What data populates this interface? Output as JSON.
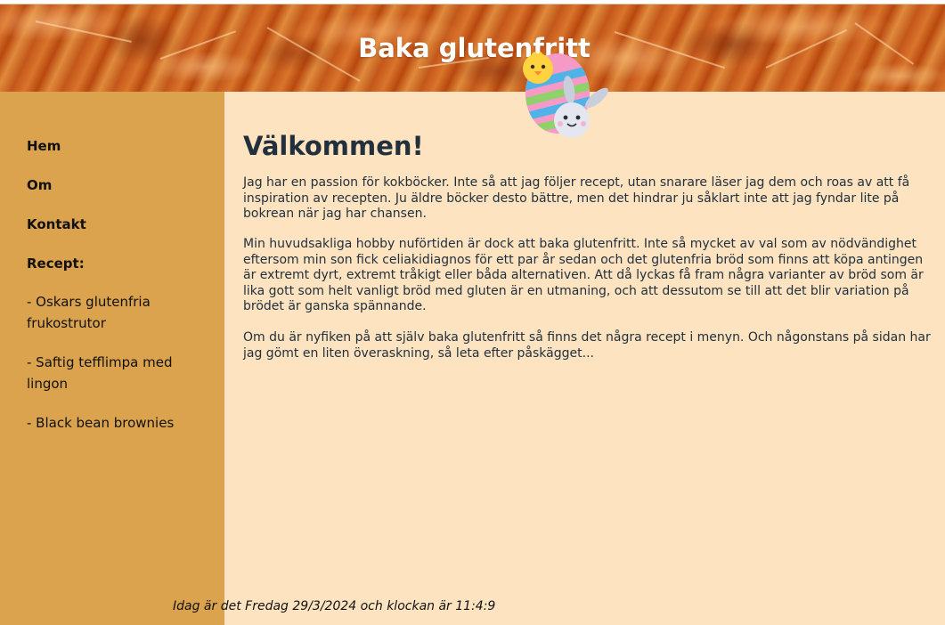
{
  "header": {
    "title": "Baka glutenfritt"
  },
  "sidebar": {
    "items": [
      {
        "label": "Hem"
      },
      {
        "label": "Om"
      },
      {
        "label": "Kontakt"
      },
      {
        "label": "Recept:"
      }
    ],
    "recipes": [
      {
        "label": "- Oskars glutenfria frukostrutor"
      },
      {
        "label": "- Saftig tefflimpa med lingon"
      },
      {
        "label": "- Black bean brownies"
      }
    ]
  },
  "main": {
    "heading": "Välkommen!",
    "paragraphs": [
      "Jag har en passion för kokböcker. Inte så att jag följer recept, utan snarare läser jag dem och roas av att få inspiration av recepten. Ju äldre böcker desto bättre, men det hindrar ju såklart inte att jag fyndar lite på bokrean när jag har chansen.",
      "Min huvudsakliga hobby nuförtiden är dock att baka glutenfritt. Inte så mycket av val som av nödvändighet eftersom min son fick celiakidiagnos för ett par år sedan och det glutenfria bröd som finns att köpa antingen är extremt dyrt, extremt tråkigt eller båda alternativen. Att då lyckas få fram några varianter av bröd som är lika gott som helt vanligt bröd med gluten är en utmaning, och att dessutom se till att det blir variation på brödet är ganska spännande.",
      "Om du är nyfiken på att själv baka glutenfritt så finns det några recept i menyn. Och någonstans på sidan har jag gömt en liten överaskning, så leta efter påskägget..."
    ]
  },
  "footer": {
    "datetime": "Idag är det Fredag 29/3/2024 och klockan är 11:4:9"
  },
  "colors": {
    "sidebar": "#dba34d",
    "content_bg": "#fde3c0",
    "text": "#22303d"
  },
  "icons": {
    "easter": "easter-egg-chick-bunny-icon"
  }
}
